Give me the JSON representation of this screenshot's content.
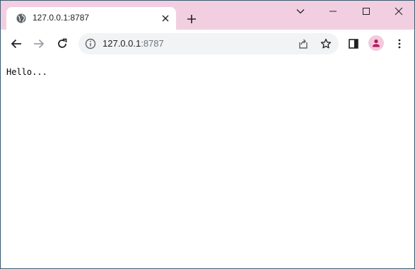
{
  "tab": {
    "title": "127.0.0.1:8787",
    "favicon": "globe-icon"
  },
  "window_controls": {
    "icons": [
      "chevron-down-icon",
      "minimize-icon",
      "maximize-icon",
      "close-icon"
    ]
  },
  "address_bar": {
    "host": "127.0.0.1",
    "port": ":8787",
    "leading_icon": "info-icon"
  },
  "page": {
    "text": "Hello..."
  },
  "colors": {
    "tabstrip": "#f2cfe0",
    "omnibox": "#f1f3f4",
    "avatar_bg": "#f4c9dd",
    "avatar_fg": "#b2185a",
    "icon": "#202124"
  }
}
